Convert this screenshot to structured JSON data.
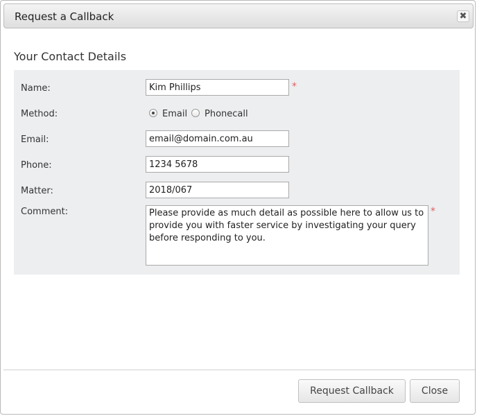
{
  "dialog": {
    "title": "Request a Callback",
    "close_glyph": "✖"
  },
  "section": {
    "title": "Your Contact Details"
  },
  "form": {
    "name": {
      "label": "Name:",
      "value": "Kim Phillips",
      "required_mark": "*"
    },
    "method": {
      "label": "Method:",
      "options": [
        {
          "label": "Email",
          "selected": true
        },
        {
          "label": "Phonecall",
          "selected": false
        }
      ]
    },
    "email": {
      "label": "Email:",
      "value": "email@domain.com.au"
    },
    "phone": {
      "label": "Phone:",
      "value": "1234 5678"
    },
    "matter": {
      "label": "Matter:",
      "value": "2018/067"
    },
    "comment": {
      "label": "Comment:",
      "value": "Please provide as much detail as possible here to allow us to provide you with faster service by investigating your query before responding to you.",
      "required_mark": "*"
    }
  },
  "footer": {
    "submit_label": "Request Callback",
    "close_label": "Close"
  }
}
